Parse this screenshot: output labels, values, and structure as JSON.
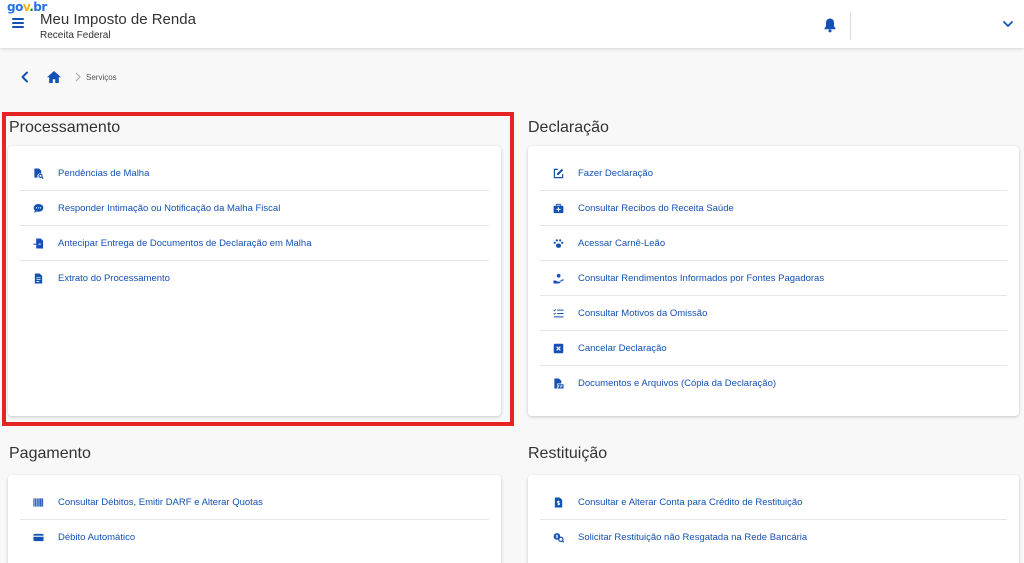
{
  "header": {
    "logo": {
      "p1": "go",
      "p2": "v",
      "p3": ".",
      "p4": "br"
    },
    "title": "Meu Imposto de Renda",
    "subtitle": "Receita Federal",
    "icons": {
      "menu": "hamburger-menu-icon",
      "notifications": "bell-icon",
      "account": "chevron-down-icon"
    }
  },
  "breadcrumb": {
    "back_icon": "chevron-left-icon",
    "home_icon": "home-icon",
    "separator_icon": "chevron-right-icon",
    "current": "Serviços"
  },
  "colors": {
    "link": "#1351b4",
    "highlight": "#e52521",
    "background": "#f8f8f8"
  },
  "sections": {
    "processamento": {
      "title": "Processamento",
      "items": [
        {
          "label": "Pendências de Malha",
          "icon": "file-search-icon"
        },
        {
          "label": "Responder Intimação ou Notificação da Malha Fiscal",
          "icon": "comment-icon"
        },
        {
          "label": "Antecipar Entrega de Documentos de Declaração em Malha",
          "icon": "file-import-icon"
        },
        {
          "label": "Extrato do Processamento",
          "icon": "document-icon"
        }
      ]
    },
    "declaracao": {
      "title": "Declaração",
      "items": [
        {
          "label": "Fazer Declaração",
          "icon": "edit-icon"
        },
        {
          "label": "Consultar Recibos do Receita Saúde",
          "icon": "medical-kit-icon"
        },
        {
          "label": "Acessar Carnê-Leão",
          "icon": "paw-icon"
        },
        {
          "label": "Consultar Rendimentos Informados por Fontes Pagadoras",
          "icon": "hand-coin-icon"
        },
        {
          "label": "Consultar Motivos da Omissão",
          "icon": "checklist-icon"
        },
        {
          "label": "Cancelar Declaração",
          "icon": "close-box-icon"
        },
        {
          "label": "Documentos e Arquivos (Cópia da Declaração)",
          "icon": "pdf-file-icon"
        }
      ]
    },
    "pagamento": {
      "title": "Pagamento",
      "items": [
        {
          "label": "Consultar Débitos, Emitir DARF e Alterar Quotas",
          "icon": "barcode-icon"
        },
        {
          "label": "Débito Automático",
          "icon": "credit-card-icon"
        }
      ]
    },
    "restituicao": {
      "title": "Restituição",
      "items": [
        {
          "label": "Consultar e Alterar Conta para Crédito de Restituição",
          "icon": "bank-file-icon"
        },
        {
          "label": "Solicitar Restituição não Resgatada na Rede Bancária",
          "icon": "coins-search-icon"
        }
      ]
    }
  }
}
